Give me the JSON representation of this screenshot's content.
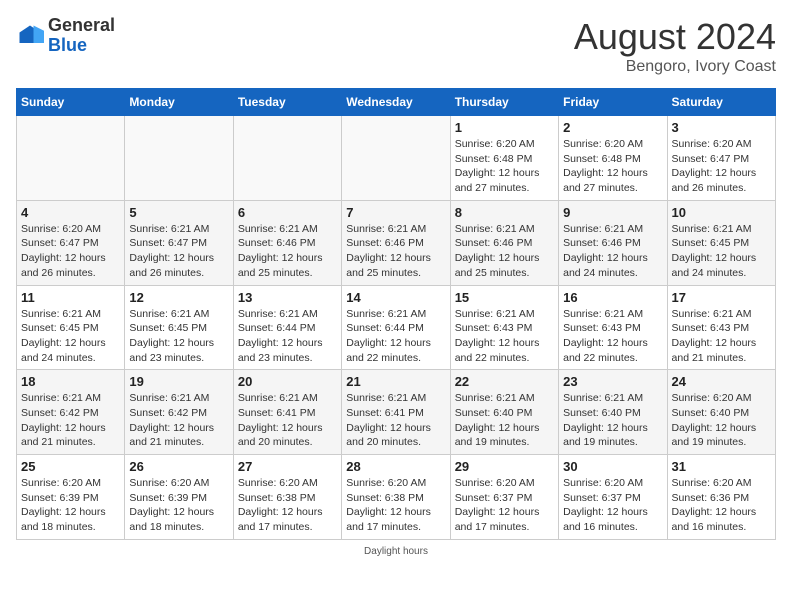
{
  "header": {
    "logo_general": "General",
    "logo_blue": "Blue",
    "month_year": "August 2024",
    "location": "Bengoro, Ivory Coast"
  },
  "days_of_week": [
    "Sunday",
    "Monday",
    "Tuesday",
    "Wednesday",
    "Thursday",
    "Friday",
    "Saturday"
  ],
  "weeks": [
    [
      {
        "day": "",
        "info": ""
      },
      {
        "day": "",
        "info": ""
      },
      {
        "day": "",
        "info": ""
      },
      {
        "day": "",
        "info": ""
      },
      {
        "day": "1",
        "info": "Sunrise: 6:20 AM\nSunset: 6:48 PM\nDaylight: 12 hours\nand 27 minutes."
      },
      {
        "day": "2",
        "info": "Sunrise: 6:20 AM\nSunset: 6:48 PM\nDaylight: 12 hours\nand 27 minutes."
      },
      {
        "day": "3",
        "info": "Sunrise: 6:20 AM\nSunset: 6:47 PM\nDaylight: 12 hours\nand 26 minutes."
      }
    ],
    [
      {
        "day": "4",
        "info": "Sunrise: 6:20 AM\nSunset: 6:47 PM\nDaylight: 12 hours\nand 26 minutes."
      },
      {
        "day": "5",
        "info": "Sunrise: 6:21 AM\nSunset: 6:47 PM\nDaylight: 12 hours\nand 26 minutes."
      },
      {
        "day": "6",
        "info": "Sunrise: 6:21 AM\nSunset: 6:46 PM\nDaylight: 12 hours\nand 25 minutes."
      },
      {
        "day": "7",
        "info": "Sunrise: 6:21 AM\nSunset: 6:46 PM\nDaylight: 12 hours\nand 25 minutes."
      },
      {
        "day": "8",
        "info": "Sunrise: 6:21 AM\nSunset: 6:46 PM\nDaylight: 12 hours\nand 25 minutes."
      },
      {
        "day": "9",
        "info": "Sunrise: 6:21 AM\nSunset: 6:46 PM\nDaylight: 12 hours\nand 24 minutes."
      },
      {
        "day": "10",
        "info": "Sunrise: 6:21 AM\nSunset: 6:45 PM\nDaylight: 12 hours\nand 24 minutes."
      }
    ],
    [
      {
        "day": "11",
        "info": "Sunrise: 6:21 AM\nSunset: 6:45 PM\nDaylight: 12 hours\nand 24 minutes."
      },
      {
        "day": "12",
        "info": "Sunrise: 6:21 AM\nSunset: 6:45 PM\nDaylight: 12 hours\nand 23 minutes."
      },
      {
        "day": "13",
        "info": "Sunrise: 6:21 AM\nSunset: 6:44 PM\nDaylight: 12 hours\nand 23 minutes."
      },
      {
        "day": "14",
        "info": "Sunrise: 6:21 AM\nSunset: 6:44 PM\nDaylight: 12 hours\nand 22 minutes."
      },
      {
        "day": "15",
        "info": "Sunrise: 6:21 AM\nSunset: 6:43 PM\nDaylight: 12 hours\nand 22 minutes."
      },
      {
        "day": "16",
        "info": "Sunrise: 6:21 AM\nSunset: 6:43 PM\nDaylight: 12 hours\nand 22 minutes."
      },
      {
        "day": "17",
        "info": "Sunrise: 6:21 AM\nSunset: 6:43 PM\nDaylight: 12 hours\nand 21 minutes."
      }
    ],
    [
      {
        "day": "18",
        "info": "Sunrise: 6:21 AM\nSunset: 6:42 PM\nDaylight: 12 hours\nand 21 minutes."
      },
      {
        "day": "19",
        "info": "Sunrise: 6:21 AM\nSunset: 6:42 PM\nDaylight: 12 hours\nand 21 minutes."
      },
      {
        "day": "20",
        "info": "Sunrise: 6:21 AM\nSunset: 6:41 PM\nDaylight: 12 hours\nand 20 minutes."
      },
      {
        "day": "21",
        "info": "Sunrise: 6:21 AM\nSunset: 6:41 PM\nDaylight: 12 hours\nand 20 minutes."
      },
      {
        "day": "22",
        "info": "Sunrise: 6:21 AM\nSunset: 6:40 PM\nDaylight: 12 hours\nand 19 minutes."
      },
      {
        "day": "23",
        "info": "Sunrise: 6:21 AM\nSunset: 6:40 PM\nDaylight: 12 hours\nand 19 minutes."
      },
      {
        "day": "24",
        "info": "Sunrise: 6:20 AM\nSunset: 6:40 PM\nDaylight: 12 hours\nand 19 minutes."
      }
    ],
    [
      {
        "day": "25",
        "info": "Sunrise: 6:20 AM\nSunset: 6:39 PM\nDaylight: 12 hours\nand 18 minutes."
      },
      {
        "day": "26",
        "info": "Sunrise: 6:20 AM\nSunset: 6:39 PM\nDaylight: 12 hours\nand 18 minutes."
      },
      {
        "day": "27",
        "info": "Sunrise: 6:20 AM\nSunset: 6:38 PM\nDaylight: 12 hours\nand 17 minutes."
      },
      {
        "day": "28",
        "info": "Sunrise: 6:20 AM\nSunset: 6:38 PM\nDaylight: 12 hours\nand 17 minutes."
      },
      {
        "day": "29",
        "info": "Sunrise: 6:20 AM\nSunset: 6:37 PM\nDaylight: 12 hours\nand 17 minutes."
      },
      {
        "day": "30",
        "info": "Sunrise: 6:20 AM\nSunset: 6:37 PM\nDaylight: 12 hours\nand 16 minutes."
      },
      {
        "day": "31",
        "info": "Sunrise: 6:20 AM\nSunset: 6:36 PM\nDaylight: 12 hours\nand 16 minutes."
      }
    ]
  ],
  "footer_note": "Daylight hours"
}
